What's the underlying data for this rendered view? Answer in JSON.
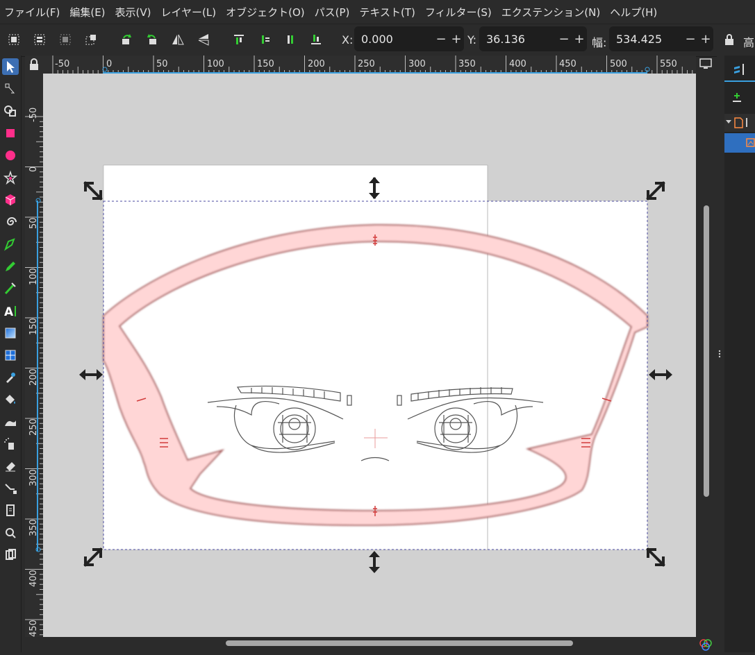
{
  "menu": {
    "items": [
      "ファイル(F)",
      "編集(E)",
      "表示(V)",
      "レイヤー(L)",
      "オブジェクト(O)",
      "パス(P)",
      "テキスト(T)",
      "フィルター(S)",
      "エクステンション(N)",
      "ヘルプ(H)"
    ]
  },
  "toolbar": {
    "x_label": "X:",
    "x_value": "0.000",
    "y_label": "Y:",
    "y_value": "36.136",
    "w_label": "幅:",
    "w_value": "534.425",
    "h_label_partial": "高",
    "minus": "−",
    "plus": "+"
  },
  "hruler": {
    "ticks": [
      "-50",
      "0",
      "50",
      "100",
      "150",
      "200",
      "250",
      "300",
      "350",
      "400",
      "450",
      "500",
      "550"
    ]
  },
  "vruler": {
    "ticks": [
      "-50",
      "0",
      "50",
      "100",
      "150",
      "200",
      "250",
      "300",
      "350",
      "400",
      "450"
    ]
  },
  "tools": [
    "selector-icon",
    "node-icon",
    "shape-builder-icon",
    "rectangle-icon",
    "ellipse-icon",
    "star-icon",
    "box3d-icon",
    "spiral-icon",
    "pen-icon",
    "pencil-icon",
    "calligraphy-icon",
    "text-icon",
    "gradient-icon",
    "mesh-icon",
    "dropper-icon",
    "paint-bucket-icon",
    "tweak-icon",
    "spray-icon",
    "eraser-icon",
    "connector-icon",
    "pages-icon",
    "zoom-icon",
    "measure-icon"
  ],
  "colors": {
    "accent": "#3d6fb3",
    "ruler_indicator": "#3aa0e0",
    "frame_fill": "#ffd6d6",
    "frame_stroke": "#b07070",
    "canvas_bg": "#d1d1d1",
    "selection_dash": "#4a4aa0"
  }
}
